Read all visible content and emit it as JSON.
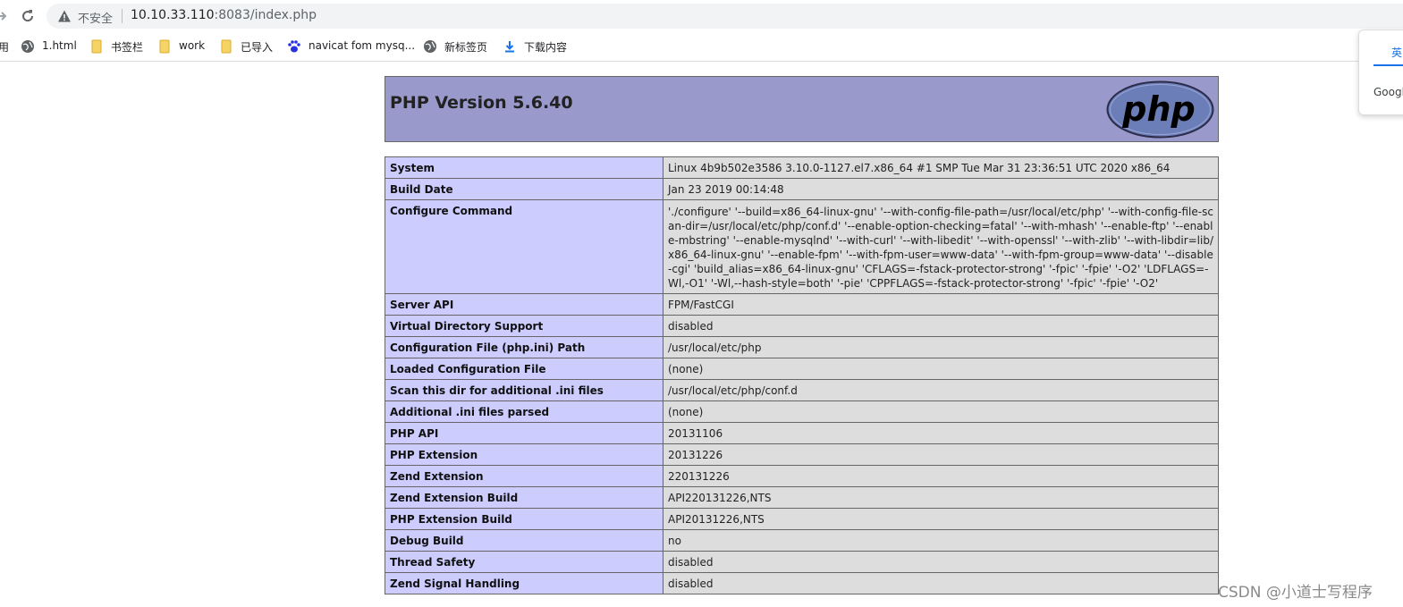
{
  "browser": {
    "insecure_label": "不安全",
    "url_host": "10.10.33.110",
    "url_rest": ":8083/index.php",
    "bookmarks": [
      {
        "label": "用",
        "icon": "apps-icon"
      },
      {
        "label": "1.html",
        "icon": "globe-icon"
      },
      {
        "label": "书签栏",
        "icon": "folder-icon"
      },
      {
        "label": "work",
        "icon": "folder-icon"
      },
      {
        "label": "已导入",
        "icon": "folder-icon"
      },
      {
        "label": "navicat fom mysq...",
        "icon": "baidu-paw-icon"
      },
      {
        "label": "新标签页",
        "icon": "globe-icon"
      },
      {
        "label": "下载内容",
        "icon": "download-icon"
      }
    ],
    "translate_popup": {
      "tab_label": "英",
      "text": "Googl"
    }
  },
  "phpinfo": {
    "title": "PHP Version 5.6.40",
    "logo_text": "php",
    "rows": [
      {
        "key": "System",
        "value": "Linux 4b9b502e3586 3.10.0-1127.el7.x86_64 #1 SMP Tue Mar 31 23:36:51 UTC 2020 x86_64"
      },
      {
        "key": "Build Date",
        "value": "Jan 23 2019 00:14:48"
      },
      {
        "key": "Configure Command",
        "value": "'./configure' '--build=x86_64-linux-gnu' '--with-config-file-path=/usr/local/etc/php' '--with-config-file-scan-dir=/usr/local/etc/php/conf.d' '--enable-option-checking=fatal' '--with-mhash' '--enable-ftp' '--enable-mbstring' '--enable-mysqlnd' '--with-curl' '--with-libedit' '--with-openssl' '--with-zlib' '--with-libdir=lib/x86_64-linux-gnu' '--enable-fpm' '--with-fpm-user=www-data' '--with-fpm-group=www-data' '--disable-cgi' 'build_alias=x86_64-linux-gnu' 'CFLAGS=-fstack-protector-strong' '-fpic' '-fpie' '-O2' 'LDFLAGS=-Wl,-O1' '-Wl,--hash-style=both' '-pie' 'CPPFLAGS=-fstack-protector-strong' '-fpic' '-fpie' '-O2'"
      },
      {
        "key": "Server API",
        "value": "FPM/FastCGI"
      },
      {
        "key": "Virtual Directory Support",
        "value": "disabled"
      },
      {
        "key": "Configuration File (php.ini) Path",
        "value": "/usr/local/etc/php"
      },
      {
        "key": "Loaded Configuration File",
        "value": "(none)"
      },
      {
        "key": "Scan this dir for additional .ini files",
        "value": "/usr/local/etc/php/conf.d"
      },
      {
        "key": "Additional .ini files parsed",
        "value": "(none)"
      },
      {
        "key": "PHP API",
        "value": "20131106"
      },
      {
        "key": "PHP Extension",
        "value": "20131226"
      },
      {
        "key": "Zend Extension",
        "value": "220131226"
      },
      {
        "key": "Zend Extension Build",
        "value": "API220131226,NTS"
      },
      {
        "key": "PHP Extension Build",
        "value": "API20131226,NTS"
      },
      {
        "key": "Debug Build",
        "value": "no"
      },
      {
        "key": "Thread Safety",
        "value": "disabled"
      },
      {
        "key": "Zend Signal Handling",
        "value": "disabled"
      }
    ]
  },
  "watermark": "CSDN @小道士写程序",
  "colors": {
    "header_bg": "#9999cc",
    "key_cell_bg": "#ccccff",
    "value_cell_bg": "#dddddd",
    "logo_bg": "#6c7eb7"
  }
}
